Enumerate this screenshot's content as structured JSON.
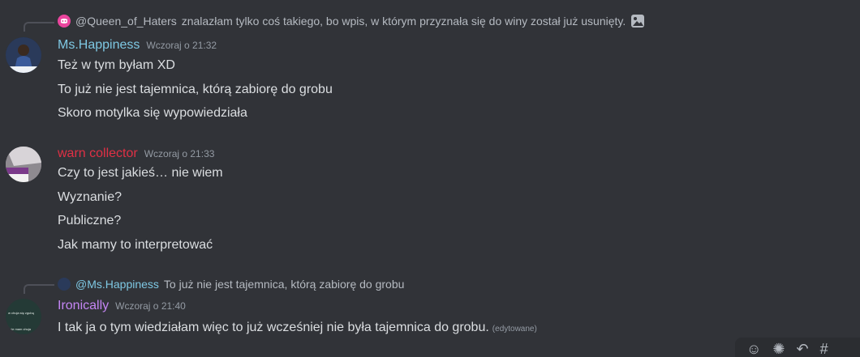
{
  "reply1": {
    "name": "@Queen_of_Haters",
    "text": "znalazłam tylko coś takiego, bo wpis, w którym przyznała się do winy został już usunięty."
  },
  "messages": [
    {
      "user": "Ms.Happiness",
      "user_color": "#7ec8e3",
      "time": "Wczoraj o 21:32",
      "lines": [
        "Też w tym byłam XD",
        "To już nie jest tajemnica, którą zabiorę do grobu",
        "Skoro motylka się wypowiedziała"
      ]
    },
    {
      "user": "warn collector",
      "user_color": "#e03045",
      "time": "Wczoraj o 21:33",
      "lines": [
        "Czy to jest jakieś… nie wiem",
        "Wyznanie?",
        "Publiczne?",
        "Jak mamy to interpretować"
      ]
    },
    {
      "user": "Ironically",
      "user_color": "#c586f5",
      "time": "Wczoraj o 21:40",
      "lines": [
        "I tak ja o tym wiedziałam więc to już wcześniej nie była tajemnica do grobu."
      ],
      "edited": "(edytowane)"
    }
  ],
  "reply2": {
    "name": "@Ms.Happiness",
    "text": "To już nie jest tajemnica, którą zabiorę do grobu"
  },
  "avatar3_text": [
    "w chuja się zgubą",
    "nie mam chuja"
  ],
  "icons": [
    "discord-icon",
    "image-icon",
    "ms-happiness-avatar",
    "warn-collector-avatar",
    "ironically-avatar",
    "add-reaction-icon",
    "super-reaction-icon",
    "reply-icon",
    "thread-icon"
  ]
}
